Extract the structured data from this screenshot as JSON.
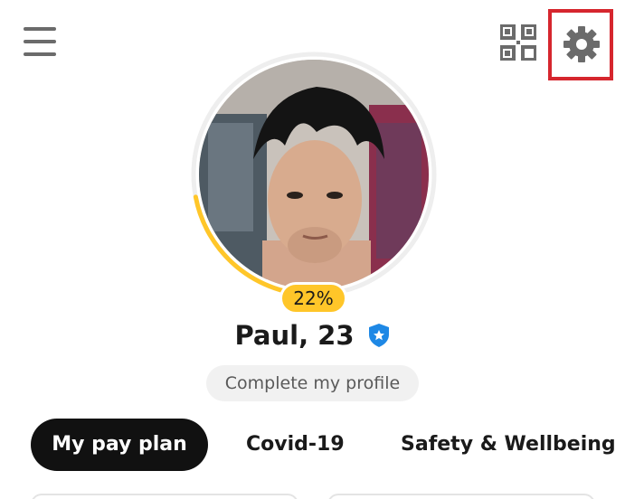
{
  "header": {
    "menu_icon": "hamburger-menu-icon",
    "qr_icon": "qr-code-icon",
    "settings_icon": "gear-icon"
  },
  "profile": {
    "progress_percent": 22,
    "progress_label": "22%",
    "name_age": "Paul, 23",
    "verified_icon": "verified-badge-icon",
    "complete_button": "Complete my profile"
  },
  "tabs": [
    {
      "label": "My pay plan",
      "active": true
    },
    {
      "label": "Covid-19",
      "active": false
    },
    {
      "label": "Safety & Wellbeing",
      "active": false
    }
  ],
  "colors": {
    "accent": "#ffc629",
    "highlight_box": "#d6262e",
    "active_tab": "#111111",
    "verified": "#1e88e5"
  }
}
